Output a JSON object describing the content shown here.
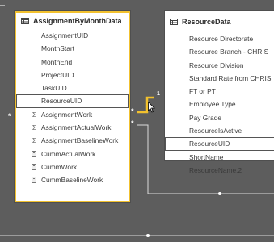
{
  "colors": {
    "canvas": "#5d5d5d",
    "selection_border": "#f2c12e",
    "relationship_active": "#f2c12e",
    "relationship_inactive": "#ffffff"
  },
  "tables": {
    "assignment": {
      "title": "AssignmentByMonthData",
      "icon": "table-icon",
      "fields": [
        {
          "label": "AssignmentUID",
          "icon": ""
        },
        {
          "label": "MonthStart",
          "icon": ""
        },
        {
          "label": "MonthEnd",
          "icon": ""
        },
        {
          "label": "ProjectUID",
          "icon": ""
        },
        {
          "label": "TaskUID",
          "icon": ""
        },
        {
          "label": "ResourceUID",
          "icon": "",
          "highlight": true
        },
        {
          "label": "AssignmentWork",
          "icon": "sum-icon"
        },
        {
          "label": "AssignmentActualWork",
          "icon": "sum-icon"
        },
        {
          "label": "AssignmentBaselineWork",
          "icon": "sum-icon"
        },
        {
          "label": "CummActualWork",
          "icon": "calculated-column-icon"
        },
        {
          "label": "CummWork",
          "icon": "calculated-column-icon"
        },
        {
          "label": "CummBaselineWork",
          "icon": "calculated-column-icon"
        }
      ]
    },
    "resource": {
      "title": "ResourceData",
      "icon": "table-icon",
      "fields": [
        {
          "label": "Resource Directorate"
        },
        {
          "label": "Resource Branch - CHRIS"
        },
        {
          "label": "Resource Division"
        },
        {
          "label": "Standard Rate from CHRIS"
        },
        {
          "label": "FT or PT"
        },
        {
          "label": "Employee Type"
        },
        {
          "label": "Pay Grade"
        },
        {
          "label": "ResourceIsActive"
        },
        {
          "label": "ResourceUID",
          "highlight": true
        },
        {
          "label": "ShortName"
        },
        {
          "label": "ResourceName.2"
        }
      ]
    }
  },
  "relationships": {
    "one_marker": "1",
    "many_marker": "*"
  }
}
